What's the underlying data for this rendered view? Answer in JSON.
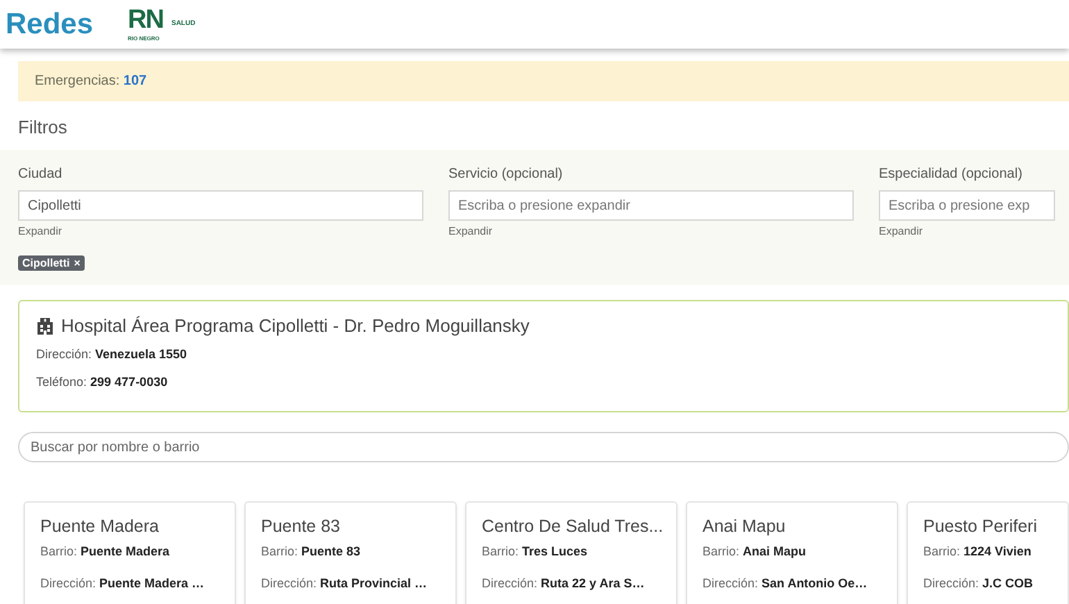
{
  "header": {
    "title": "Redes",
    "logo": {
      "mark": "RN",
      "subtitle": "RIO NEGRO",
      "tag": "SALUD"
    }
  },
  "alert": {
    "label": "Emergencias:",
    "value": "107"
  },
  "filters": {
    "title": "Filtros",
    "fields": [
      {
        "label": "Ciudad",
        "value": "Cipolletti",
        "hint": "Expandir",
        "chips": [
          {
            "label": "Cipolletti",
            "remove": "×"
          }
        ]
      },
      {
        "label": "Servicio (opcional)",
        "placeholder": "Escriba o presione expandir",
        "hint": "Expandir"
      },
      {
        "label": "Especialidad (opcional)",
        "placeholder": "Escriba o presione exp",
        "hint": "Expandir"
      }
    ]
  },
  "hospital": {
    "name": "Hospital Área Programa Cipolletti - Dr. Pedro Moguillansky",
    "lines": [
      "Dirección: **Venezuela 1550**",
      "Teléfono: **299 477-0030**"
    ]
  },
  "search": {
    "placeholder": "Buscar por nombre o barrio"
  },
  "centers": [
    {
      "name": "Puente Madera",
      "barrio": "Barrio: **Puente Madera**",
      "direccion": "Dirección: **Puente Madera …**"
    },
    {
      "name": "Puente 83",
      "barrio": "Barrio: **Puente 83**",
      "direccion": "Dirección: **Ruta Provincial …**"
    },
    {
      "name": "Centro De Salud Tres...",
      "barrio": "Barrio: **Tres Luces**",
      "direccion": "Dirección: **Ruta 22 y Ara S…**"
    },
    {
      "name": "Anai Mapu",
      "barrio": "Barrio: **Anai Mapu**",
      "direccion": "Dirección: **San Antonio Oe…**"
    },
    {
      "name": "Puesto Periferi",
      "barrio": "Barrio: **1224 Vivien**",
      "direccion": "Dirección: **J.C COB**"
    }
  ]
}
